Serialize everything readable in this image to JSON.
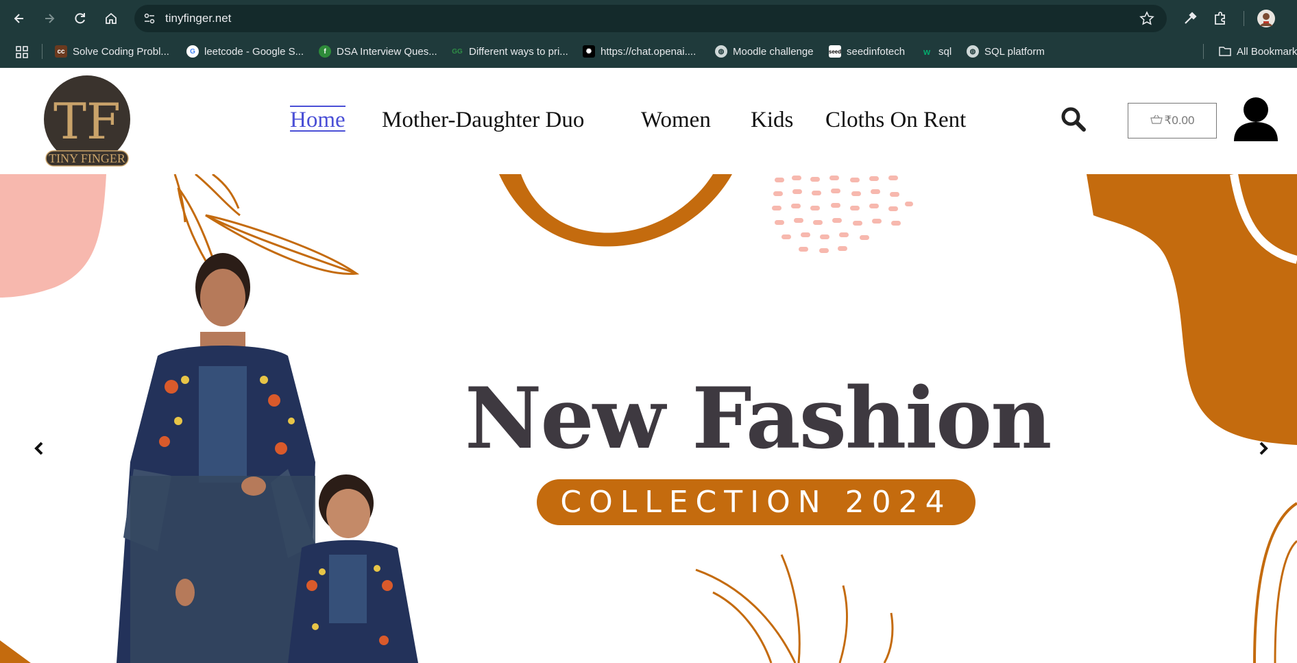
{
  "browser": {
    "url": "tinyfinger.net",
    "bookmarks": [
      {
        "label": "Solve Coding Probl...",
        "icon": "cc-icon"
      },
      {
        "label": "leetcode - Google S...",
        "icon": "google-icon"
      },
      {
        "label": "DSA Interview Ques...",
        "icon": "dsa-icon"
      },
      {
        "label": "Different ways to pri...",
        "icon": "gfg-icon"
      },
      {
        "label": "https://chat.openai....",
        "icon": "openai-icon"
      },
      {
        "label": "Moodle challenge",
        "icon": "globe-icon"
      },
      {
        "label": "seedinfotech",
        "icon": "seed-icon"
      },
      {
        "label": "sql",
        "icon": "w3-icon"
      },
      {
        "label": "SQL platform",
        "icon": "globe-icon"
      }
    ],
    "all_bookmarks": "All Bookmarks"
  },
  "site": {
    "logo_text": "TINY FINGER",
    "logo_monogram": "TF",
    "nav": [
      "Home",
      "Mother-Daughter Duo",
      "Women",
      "Kids",
      "Cloths On Rent"
    ],
    "cart_total": "₹0.00"
  },
  "hero": {
    "headline": "New Fashion",
    "subheadline": "COLLECTION 2024"
  },
  "colors": {
    "accent": "#c46b0e",
    "pink": "#f7b8ae",
    "headline": "#3e3940",
    "chrome": "#1f3a3b"
  }
}
